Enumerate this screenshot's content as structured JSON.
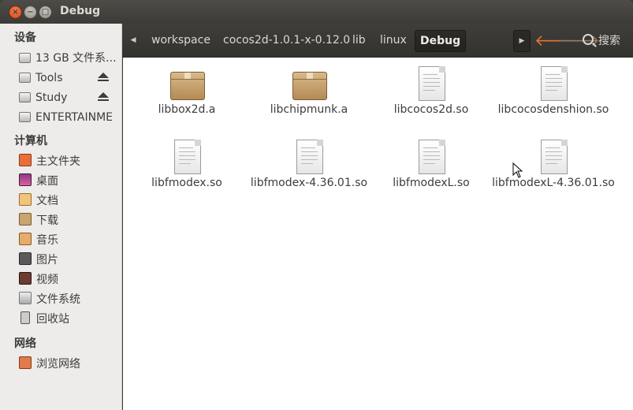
{
  "window": {
    "title": "Debug"
  },
  "sidebar": {
    "sections": [
      {
        "heading": "设备",
        "items": [
          {
            "label": "13 GB 文件系...",
            "icon": "drive-icon"
          },
          {
            "label": "Tools",
            "icon": "drive-icon",
            "eject": true
          },
          {
            "label": "Study",
            "icon": "drive-icon",
            "eject": true
          },
          {
            "label": "ENTERTAINME",
            "icon": "drive-icon"
          }
        ]
      },
      {
        "heading": "计算机",
        "items": [
          {
            "label": "主文件夹",
            "icon": "home-folder-icon"
          },
          {
            "label": "桌面",
            "icon": "desktop-icon"
          },
          {
            "label": "文档",
            "icon": "documents-icon"
          },
          {
            "label": "下载",
            "icon": "downloads-icon"
          },
          {
            "label": "音乐",
            "icon": "music-icon"
          },
          {
            "label": "图片",
            "icon": "pictures-icon"
          },
          {
            "label": "视频",
            "icon": "videos-icon"
          },
          {
            "label": "文件系统",
            "icon": "filesystem-icon"
          },
          {
            "label": "回收站",
            "icon": "trash-icon"
          }
        ]
      },
      {
        "heading": "网络",
        "items": [
          {
            "label": "浏览网络",
            "icon": "network-icon"
          }
        ]
      }
    ]
  },
  "toolbar": {
    "breadcrumbs": [
      "workspace",
      "cocos2d-1.0.1-x-0.12.0",
      "lib",
      "linux",
      "Debug"
    ],
    "search_label": "搜索"
  },
  "files": [
    {
      "name": "libbox2d.a",
      "type": "archive"
    },
    {
      "name": "libchipmunk.a",
      "type": "archive"
    },
    {
      "name": "libcocos2d.so",
      "type": "document"
    },
    {
      "name": "libcocosdenshion.so",
      "type": "document"
    },
    {
      "name": "libfmodex.so",
      "type": "document"
    },
    {
      "name": "libfmodex-4.36.01.so",
      "type": "document"
    },
    {
      "name": "libfmodexL.so",
      "type": "document"
    },
    {
      "name": "libfmodexL-4.36.01.so",
      "type": "document"
    }
  ]
}
